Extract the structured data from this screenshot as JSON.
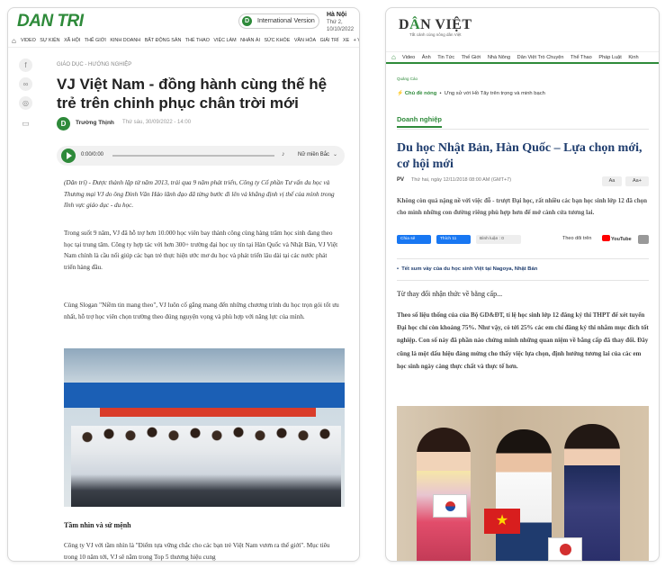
{
  "left": {
    "logo": "DAN TRI",
    "intl_label": "International Version",
    "date_line1": "Hà Nội",
    "date_line2": "Thứ 2, 10/10/2022",
    "nav_items": [
      "VIDEO",
      "SỰ KIỆN",
      "XÃ HỘI",
      "THẾ GIỚI",
      "KINH DOANH",
      "BẤT ĐỘNG SẢN",
      "THỂ THAO",
      "VIỆC LÀM",
      "NHÂN ÁI",
      "SỨC KHỎE",
      "VĂN HÓA",
      "GIẢI TRÍ",
      "XE",
      "+ V"
    ],
    "breadcrumb": "GIÁO DỤC - HƯỚNG NGHIỆP",
    "title": "VJ Việt Nam - đồng hành cùng thế hệ trẻ trên chinh phục chân trời mới",
    "author": "Trường Thịnh",
    "time": "Thứ sáu, 30/09/2022 - 14:00",
    "audio_time": "0:00/0:00",
    "audio_voice": "Nữ miền Bắc",
    "lead": "(Dân trí) - Được thành lập từ năm 2013, trải qua 9 năm phát triển, Công ty Cổ phần Tư vấn du học và Thương mại VJ do ông Đinh Văn Hảo lãnh đạo đã từng bước đi lên và khẳng định vị thế của mình trong lĩnh vực giáo dục - du học.",
    "p1": "Trong suốt 9 năm, VJ đã hỗ trợ hơn 10.000 học viên bay thành công cùng hàng trăm học sinh đang theo học tại trung tâm. Công ty hợp tác với hơn 300+ trường đại học uy tín tại Hàn Quốc và Nhật Bản, VJ Việt Nam chính là cầu nối giúp các bạn trẻ thực hiện ước mơ du học và phát triển lâu dài tại các nước phát triển hàng đầu.",
    "p2": "Cùng Slogan \"Niềm tin mang theo\", VJ luôn cố gắng mang đến những chương trình du học trọn gói tốt ưu nhất, hỗ trợ học viên chọn trường theo đúng nguyện vọng và phù hợp với năng lực của mình.",
    "subhead": "Tầm nhìn và sứ mệnh",
    "p3": "Công ty VJ với tầm nhìn là \"Điểm tựa vững chắc cho các bạn trẻ Việt Nam vươn ra thế giới\". Mục tiêu trong 10 năm tới, VJ sẽ nằm trong Top 5 thương hiệu cung"
  },
  "right": {
    "logo_a": "D",
    "logo_b": "N VIỆT",
    "logo_accent": "Â",
    "tagline": "Tất cảnh cùng nông dân Việt",
    "nav_items": [
      "Video",
      "Ảnh",
      "Tin Tức",
      "Thế Giới",
      "Nhà Nông",
      "Dân Việt Trò Chuyện",
      "Thể Thao",
      "Pháp Luật",
      "Kinh"
    ],
    "crumb": "Quảng Cáo",
    "hot_label": "Chủ đề nóng",
    "hot_text": "Ưng sử với Hồ Tây trên trọng và minh bạch",
    "section": "Doanh nghiệp",
    "title": "Du học Nhật Bản, Hàn Quốc – Lựa chọn mới, cơ hội mới",
    "author": "PV",
    "time": "Thứ hai, ngày 12/11/2018 08:00 AM (GMT+7)",
    "font_small": "Aa",
    "font_large": "Aa+",
    "lead": "Không còn quá nặng nề với việc đỗ - trượt Đại học, rất nhiều các bạn học sinh lớp 12 đã chọn cho mình những con đường riêng phù hợp hơn để mở cánh cửa tương lai.",
    "share1": "Chia sẻ",
    "share2": "Thích 11",
    "share3": "Bình luận : 0",
    "follow": "Theo dõi trên",
    "youtube": "YouTube",
    "related": "Tết sum vầy của du học sinh Việt tại Nagoya, Nhật Bản",
    "heading": "Từ thay đổi nhận thức về bằng cấp...",
    "body": "Theo số liệu thống của của Bộ GD&ĐT, tỉ lệ học sinh lớp 12 đăng ký thi THPT để xét tuyển Đại học chỉ còn khoảng 75%. Như vậy, có tới 25% các em chỉ đăng ký thi nhằm mục đích tốt nghiệp. Con số này đã phần nào chứng minh những quan niệm về bằng cấp đã thay đổi. Đây cũng là một dấu hiệu đáng mừng cho thấy việc lựa chọn, định hướng tương lai của các em học sinh ngày càng thực chất và thực tế hơn."
  },
  "colors": {
    "brand_green": "#2e8a3a",
    "title_blue": "#1f3d6e",
    "facebook": "#1877f2",
    "youtube": "#ff0000"
  }
}
